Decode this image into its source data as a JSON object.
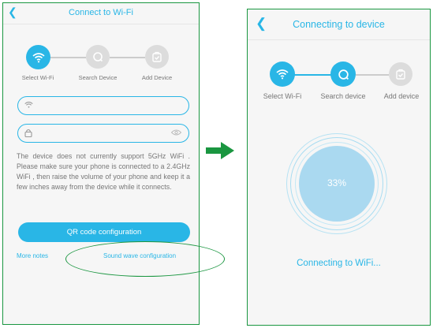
{
  "annotation_color": "#1a9640",
  "accent_color": "#29b6e6",
  "left_screen": {
    "title": "Connect to Wi-Fi",
    "back_icon": "chevron-left-icon",
    "steps": [
      {
        "label": "Select Wi-Fi",
        "icon": "wifi-icon",
        "state": "active"
      },
      {
        "label": "Search Device",
        "icon": "search-icon",
        "state": "inactive"
      },
      {
        "label": "Add Device",
        "icon": "check-bag-icon",
        "state": "inactive"
      }
    ],
    "wifi_input": {
      "icon": "wifi-icon",
      "value": "",
      "placeholder": ""
    },
    "password_input": {
      "icon": "lock-icon",
      "value": "",
      "placeholder": "",
      "toggle_icon": "eye-icon"
    },
    "notice": "The device does not currently support 5GHz WiFi . Please make sure your phone is connected to a 2.4GHz WiFi , then raise the volume of your phone and keep it a few inches away from the device while it connects.",
    "qr_button_label": "QR code configuration",
    "more_notes_label": "More notes",
    "sound_wave_label": "Sound wave configuration"
  },
  "right_screen": {
    "title": "Connecting to device",
    "back_icon": "chevron-left-icon",
    "steps": [
      {
        "label": "Select Wi-Fi",
        "icon": "wifi-icon",
        "state": "done"
      },
      {
        "label": "Search device",
        "icon": "search-icon",
        "state": "active"
      },
      {
        "label": "Add device",
        "icon": "check-bag-icon",
        "state": "inactive"
      }
    ],
    "progress_percent": 33,
    "progress_label": "33%",
    "status_text": "Connecting to WiFi..."
  }
}
